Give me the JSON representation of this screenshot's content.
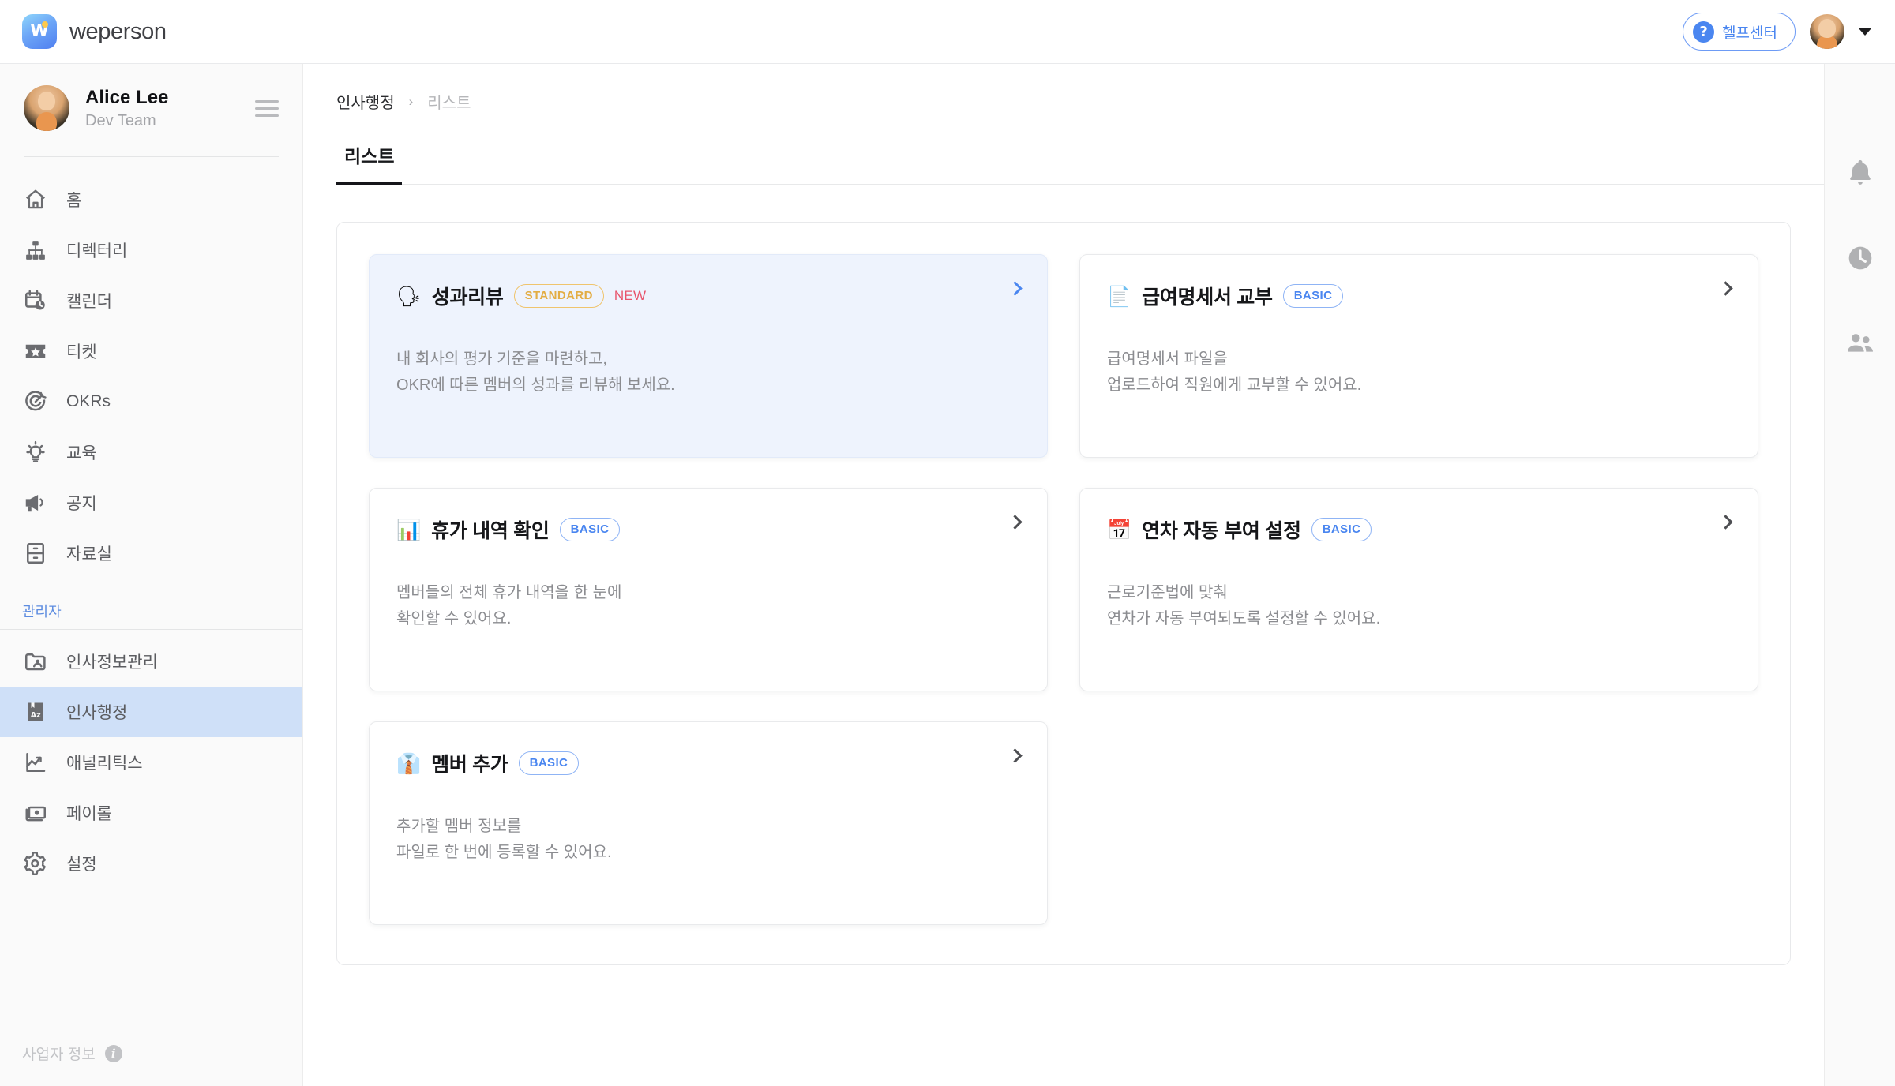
{
  "app": {
    "brand_name": "weperson",
    "brand_mark": "W"
  },
  "topbar": {
    "help_label": "헬프센터",
    "help_icon": "question-mark-icon"
  },
  "sidebar": {
    "profile": {
      "name": "Alice Lee",
      "team": "Dev Team"
    },
    "items": [
      {
        "label": "홈",
        "icon": "home-icon"
      },
      {
        "label": "디렉터리",
        "icon": "org-chart-icon"
      },
      {
        "label": "캘린더",
        "icon": "calendar-clock-icon"
      },
      {
        "label": "티켓",
        "icon": "ticket-star-icon"
      },
      {
        "label": "OKRs",
        "icon": "target-icon"
      },
      {
        "label": "교육",
        "icon": "lightbulb-icon"
      },
      {
        "label": "공지",
        "icon": "megaphone-icon"
      },
      {
        "label": "자료실",
        "icon": "archive-icon"
      }
    ],
    "admin_header": "관리자",
    "admin_items": [
      {
        "label": "인사정보관리",
        "icon": "folder-person-icon",
        "active": false
      },
      {
        "label": "인사행정",
        "icon": "book-az-icon",
        "active": true
      },
      {
        "label": "애널리틱스",
        "icon": "line-chart-icon",
        "active": false
      },
      {
        "label": "페이롤",
        "icon": "banknote-icon",
        "active": false
      },
      {
        "label": "설정",
        "icon": "gear-icon",
        "active": false
      }
    ],
    "business_info_label": "사업자 정보"
  },
  "right_rail": {
    "items": [
      {
        "icon": "bell-icon"
      },
      {
        "icon": "clock-icon"
      },
      {
        "icon": "people-icon"
      }
    ]
  },
  "main": {
    "breadcrumb": {
      "parent": "인사행정",
      "separator": "›",
      "current": "리스트"
    },
    "tabs": [
      {
        "label": "리스트",
        "active": true
      }
    ],
    "cards": [
      {
        "emoji": "🗣",
        "icon": "speaking-head-icon",
        "title": "성과리뷰",
        "badge": "STANDARD",
        "badge_type": "standard",
        "new_tag": "NEW",
        "desc_line1": "내 회사의 평가 기준을 마련하고,",
        "desc_line2": "OKR에 따른 멤버의 성과를 리뷰해 보세요.",
        "featured": true
      },
      {
        "emoji": "📄",
        "icon": "document-icon",
        "title": "급여명세서 교부",
        "badge": "BASIC",
        "badge_type": "basic",
        "new_tag": "",
        "desc_line1": "급여명세서 파일을",
        "desc_line2": "업로드하여 직원에게 교부할 수 있어요.",
        "featured": false
      },
      {
        "emoji": "📊",
        "icon": "bar-chart-icon",
        "title": "휴가 내역 확인",
        "badge": "BASIC",
        "badge_type": "basic",
        "new_tag": "",
        "desc_line1": "멤버들의 전체 휴가 내역을 한 눈에",
        "desc_line2": "확인할 수 있어요.",
        "featured": false
      },
      {
        "emoji": "📅",
        "icon": "calendar-icon",
        "title": "연차 자동 부여 설정",
        "badge": "BASIC",
        "badge_type": "basic",
        "new_tag": "",
        "desc_line1": "근로기준법에 맞춰",
        "desc_line2": "연차가 자동 부여되도록 설정할 수 있어요.",
        "featured": false
      },
      {
        "emoji": "👔",
        "icon": "necktie-icon",
        "title": "멤버 추가",
        "badge": "BASIC",
        "badge_type": "basic",
        "new_tag": "",
        "desc_line1": "추가할 멤버 정보를",
        "desc_line2": "파일로 한 번에 등록할 수 있어요.",
        "featured": false
      }
    ]
  },
  "colors": {
    "accent_blue": "#4a86f0",
    "active_nav_bg": "#cfe0f8",
    "featured_card_bg": "#eef3fd",
    "badge_standard": "#e3ad44",
    "badge_basic": "#4a86f0",
    "new_tag": "#e8536b"
  }
}
